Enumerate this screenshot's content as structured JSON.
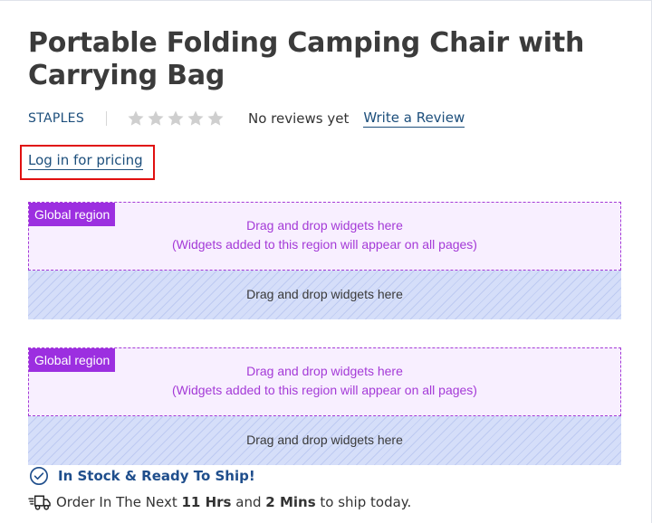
{
  "product": {
    "title": "Portable Folding Camping Chair with Carrying Bag",
    "brand": "STAPLES",
    "rating_stars": 0,
    "rating_max": 5,
    "reviews_text": "No reviews yet",
    "write_review_label": "Write a Review",
    "login_pricing_label": "Log in for pricing"
  },
  "regions": [
    {
      "global_tag": "Global region",
      "global_line1": "Drag and drop widgets here",
      "global_line2": "(Widgets added to this region will appear on all pages)",
      "local_text": "Drag and drop widgets here"
    },
    {
      "global_tag": "Global region",
      "global_line1": "Drag and drop widgets here",
      "global_line2": "(Widgets added to this region will appear on all pages)",
      "local_text": "Drag and drop widgets here"
    }
  ],
  "availability": {
    "stock_text": "In Stock & Ready To Ship!",
    "icon": "check-circle-icon"
  },
  "shipping": {
    "icon": "fast-truck-icon",
    "prefix": "Order In The Next",
    "hours": "11 Hrs",
    "and": "and",
    "mins": "2 Mins",
    "suffix": "to ship today."
  },
  "colors": {
    "link": "#1d4f7c",
    "global_accent": "#9c2fe0",
    "local_bg": "#d5def9",
    "highlight_border": "#e01010",
    "stock_text": "#1f4e8c",
    "star_empty": "#cfcfcf"
  }
}
